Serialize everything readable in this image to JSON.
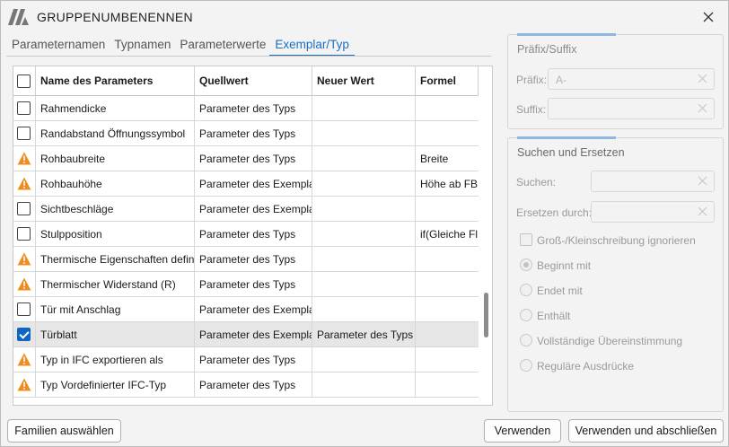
{
  "window": {
    "title": "GRUPPENUMBENENNEN"
  },
  "tabs": [
    {
      "label": "Parameternamen",
      "active": false
    },
    {
      "label": "Typnamen",
      "active": false
    },
    {
      "label": "Parameterwerte",
      "active": false
    },
    {
      "label": "Exemplar/Typ",
      "active": true
    }
  ],
  "table": {
    "headers": [
      "Name des Parameters",
      "Quellwert",
      "Neuer Wert",
      "Formel"
    ],
    "rows": [
      {
        "icon": "checkbox",
        "checked": false,
        "name": "Rahmendicke",
        "source": "Parameter des Typs",
        "new": "",
        "formula": "",
        "selected": false
      },
      {
        "icon": "checkbox",
        "checked": false,
        "name": "Randabstand Öffnungssymbol",
        "source": "Parameter des Typs",
        "new": "",
        "formula": "",
        "selected": false
      },
      {
        "icon": "warning",
        "checked": false,
        "name": "Rohbaubreite",
        "source": "Parameter des Typs",
        "new": "",
        "formula": "Breite",
        "selected": false
      },
      {
        "icon": "warning",
        "checked": false,
        "name": "Rohbauhöhe",
        "source": "Parameter des Exemplars",
        "new": "",
        "formula": "Höhe ab FB",
        "selected": false
      },
      {
        "icon": "checkbox",
        "checked": false,
        "name": "Sichtbeschläge",
        "source": "Parameter des Exemplars",
        "new": "",
        "formula": "",
        "selected": false
      },
      {
        "icon": "checkbox",
        "checked": false,
        "name": "Stulpposition",
        "source": "Parameter des Typs",
        "new": "",
        "formula": "if(Gleiche Fl",
        "selected": false
      },
      {
        "icon": "warning",
        "checked": false,
        "name": "Thermische Eigenschaften definieren",
        "source": "Parameter des Typs",
        "new": "",
        "formula": "",
        "selected": false
      },
      {
        "icon": "warning",
        "checked": false,
        "name": "Thermischer Widerstand (R)",
        "source": "Parameter des Typs",
        "new": "",
        "formula": "",
        "selected": false
      },
      {
        "icon": "checkbox",
        "checked": false,
        "name": "Tür mit Anschlag",
        "source": "Parameter des Exemplars",
        "new": "",
        "formula": "",
        "selected": false
      },
      {
        "icon": "checkbox",
        "checked": true,
        "name": "Türblatt",
        "source": "Parameter des Exemplars",
        "new": "Parameter des Typs",
        "formula": "",
        "selected": true
      },
      {
        "icon": "warning",
        "checked": false,
        "name": "Typ in IFC exportieren als",
        "source": "Parameter des Typs",
        "new": "",
        "formula": "",
        "selected": false
      },
      {
        "icon": "warning",
        "checked": false,
        "name": "Typ Vordefinierter IFC-Typ",
        "source": "Parameter des Typs",
        "new": "",
        "formula": "",
        "selected": false
      }
    ]
  },
  "prefix_suffix": {
    "title": "Präfix/Suffix",
    "prefix_label": "Präfix:",
    "prefix_value": "A-",
    "suffix_label": "Suffix:",
    "suffix_value": ""
  },
  "search_replace": {
    "title": "Suchen und Ersetzen",
    "search_label": "Suchen:",
    "replace_label": "Ersetzen durch:",
    "case_label": "Groß-/Kleinschreibung ignorieren",
    "options": [
      {
        "label": "Beginnt mit",
        "selected": true
      },
      {
        "label": "Endet mit",
        "selected": false
      },
      {
        "label": "Enthält",
        "selected": false
      },
      {
        "label": "Vollständige Übereinstimmung",
        "selected": false
      },
      {
        "label": "Reguläre Ausdrücke",
        "selected": false
      }
    ]
  },
  "buttons": {
    "select_families": "Familien auswählen",
    "apply": "Verwenden",
    "apply_close": "Verwenden und abschließen"
  },
  "colors": {
    "accent": "#1a6fc4",
    "warning": "#f08c1e",
    "checked": "#0d66c4"
  }
}
